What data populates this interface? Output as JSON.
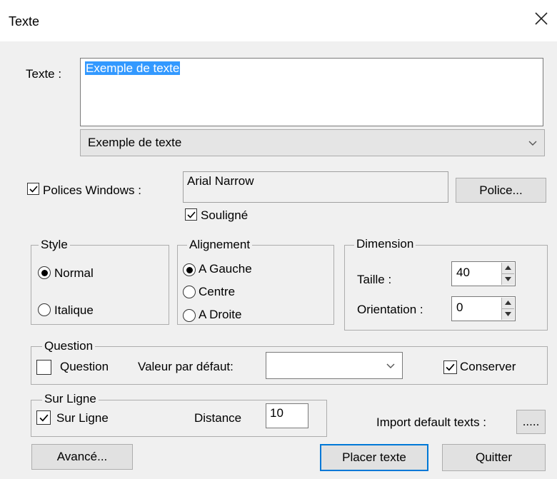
{
  "window": {
    "title": "Texte",
    "close_icon": "close-icon"
  },
  "texte": {
    "label": "Texte :",
    "value": "Exemple de texte",
    "combo_value": "Exemple de texte"
  },
  "police": {
    "checkbox_label": "Polices Windows :",
    "checked": true,
    "font_name": "Arial Narrow",
    "button_label": "Police...",
    "souligne_label": "Souligné",
    "souligne_checked": true
  },
  "style": {
    "title": "Style",
    "options": [
      {
        "label": "Normal",
        "selected": true
      },
      {
        "label": "Italique",
        "selected": false
      }
    ]
  },
  "alignement": {
    "title": "Alignement",
    "options": [
      {
        "label": "A Gauche",
        "selected": true
      },
      {
        "label": "Centre",
        "selected": false
      },
      {
        "label": "A Droite",
        "selected": false
      }
    ]
  },
  "dimension": {
    "title": "Dimension",
    "taille_label": "Taille :",
    "taille_value": "40",
    "orientation_label": "Orientation :",
    "orientation_value": "0"
  },
  "question": {
    "title": "Question",
    "checkbox_label": "Question",
    "checked": false,
    "default_label": "Valeur par défaut:",
    "default_value": "",
    "conserver_label": "Conserver",
    "conserver_checked": true
  },
  "surligne": {
    "title": "Sur Ligne",
    "checkbox_label": "Sur Ligne",
    "checked": true,
    "distance_label": "Distance",
    "distance_value": "10"
  },
  "import": {
    "label": "Import default texts :",
    "button_label": "....."
  },
  "buttons": {
    "avance": "Avancé...",
    "placer": "Placer texte",
    "quitter": "Quitter"
  }
}
